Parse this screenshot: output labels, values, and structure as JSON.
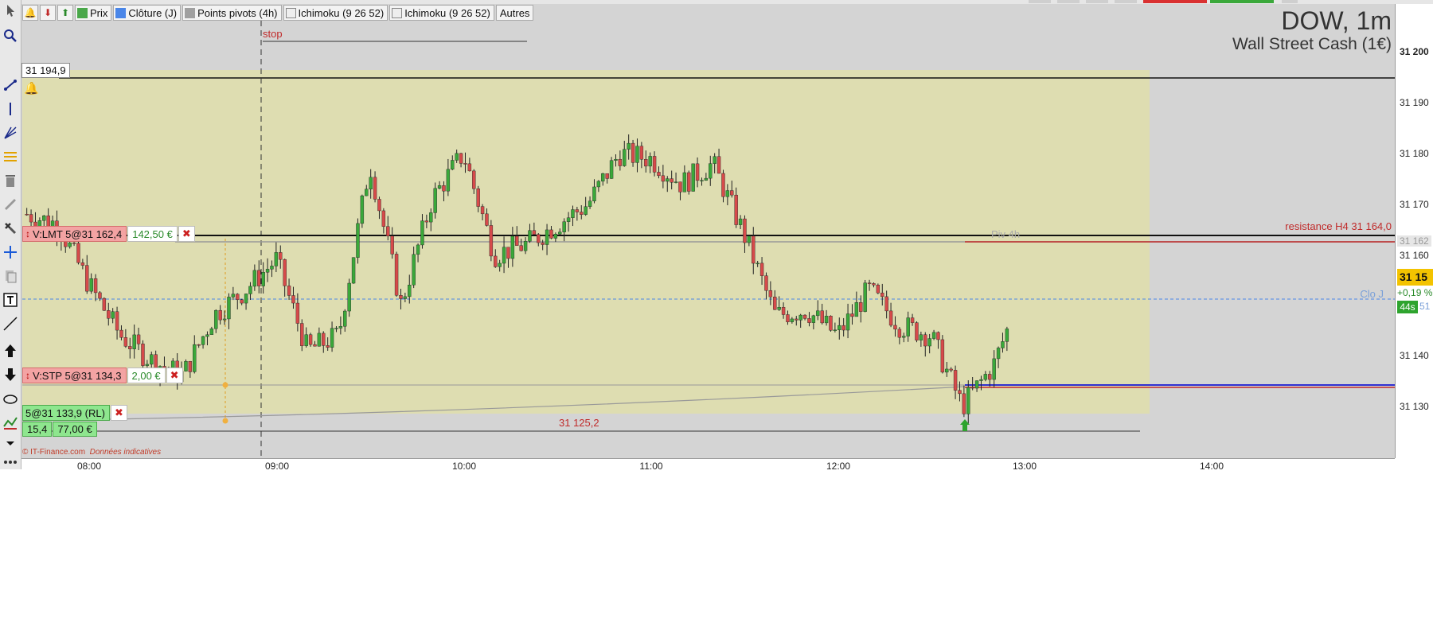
{
  "legend": {
    "items": [
      {
        "label": "Prix",
        "color": "#4aa84a"
      },
      {
        "label": "Clôture (J)",
        "color": "#4a86e8"
      },
      {
        "label": "Points pivots (4h)",
        "color": "#a0a0a0"
      },
      {
        "label": "Ichimoku (9 26 52)",
        "color": "#dddddd"
      },
      {
        "label": "Ichimoku (9 26 52)",
        "color": "#dddddd"
      }
    ],
    "more_label": "Autres"
  },
  "title": {
    "symbol": "DOW, 1m",
    "description": "Wall Street Cash (1€)"
  },
  "stop_label": "stop",
  "hline_price_label": "31 194,9",
  "orders": {
    "limit": {
      "label": "V:LMT 5@31 162,4",
      "value": "142,50 €"
    },
    "stop": {
      "label": "V:STP 5@31 134,3",
      "value": "2,00 €"
    }
  },
  "position": {
    "label": "5@31 133,9",
    "type": "(RL)",
    "points": "15,4",
    "pnl": "77,00 €"
  },
  "lines": {
    "low_label": "31 125,2",
    "pivot_label": "Piv 4h",
    "resistance_label": "resistance H4 31 164,0",
    "close_label": "Clo J"
  },
  "price_axis": {
    "labels": [
      "31 200",
      "31 190",
      "31 180",
      "31 170",
      "31 160",
      "31 140",
      "31 130"
    ],
    "current_price": "31 15",
    "variation": "+0,19 %",
    "timer": "44s",
    "timer2": "51",
    "pivot_tag": "31 162"
  },
  "time_axis": {
    "labels": [
      "08:00",
      "09:00",
      "10:00",
      "11:00",
      "12:00",
      "13:00",
      "14:00"
    ]
  },
  "copyright": {
    "source": "© IT-Finance.com",
    "note": "Données indicatives"
  },
  "colors": {
    "zone_fill": "#deddb1",
    "bull_candle": "#3aa83a",
    "bear_candle": "#d64a4a",
    "resistance": "#c02a2a",
    "close_line": "#4a86e8",
    "stop_line": "#3030d0"
  },
  "chart_data": {
    "type": "candlestick",
    "x_unit": "time",
    "y_unit": "price",
    "ylim": [
      31124,
      31204
    ],
    "closes": [
      [
        "07:40",
        31172
      ],
      [
        "07:50",
        31170
      ],
      [
        "08:00",
        31158
      ],
      [
        "08:10",
        31148
      ],
      [
        "08:20",
        31143
      ],
      [
        "08:30",
        31140
      ],
      [
        "08:40",
        31152
      ],
      [
        "08:50",
        31157
      ],
      [
        "09:00",
        31163
      ],
      [
        "09:10",
        31145
      ],
      [
        "09:20",
        31148
      ],
      [
        "09:30",
        31182
      ],
      [
        "09:40",
        31154
      ],
      [
        "09:50",
        31175
      ],
      [
        "10:00",
        31184
      ],
      [
        "10:10",
        31164
      ],
      [
        "10:20",
        31166
      ],
      [
        "10:30",
        31170
      ],
      [
        "10:40",
        31174
      ],
      [
        "10:50",
        31184
      ],
      [
        "11:00",
        31183
      ],
      [
        "11:10",
        31178
      ],
      [
        "11:20",
        31182
      ],
      [
        "11:30",
        31168
      ],
      [
        "11:40",
        31152
      ],
      [
        "11:50",
        31153
      ],
      [
        "12:00",
        31148
      ],
      [
        "12:10",
        31157
      ],
      [
        "12:20",
        31150
      ],
      [
        "12:30",
        31148
      ],
      [
        "12:40",
        31134
      ],
      [
        "12:50",
        31142
      ],
      [
        "12:55",
        31150
      ]
    ]
  }
}
